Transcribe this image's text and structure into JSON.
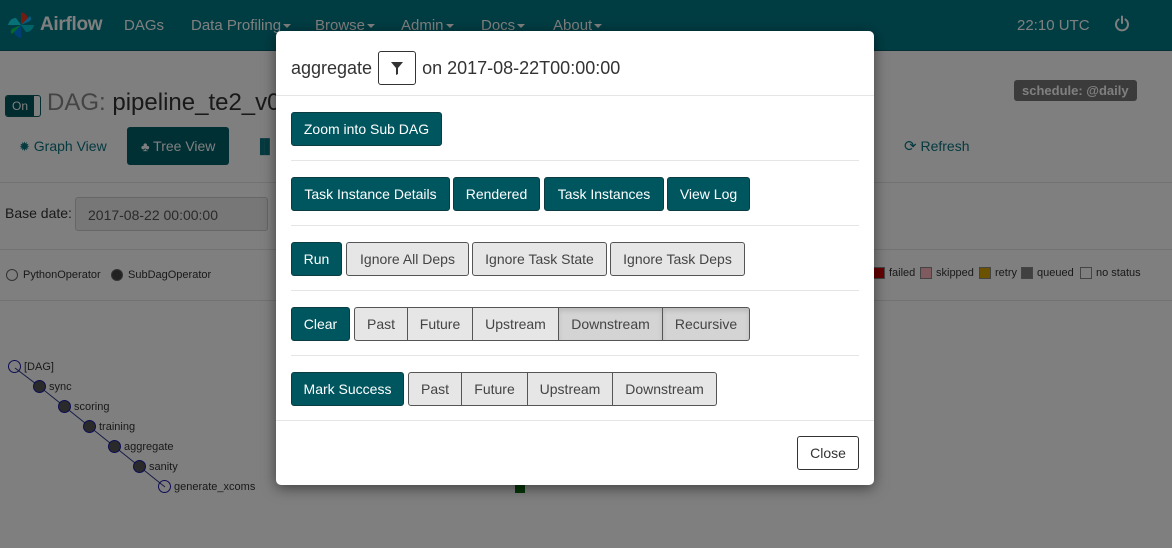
{
  "navbar": {
    "brand": "Airflow",
    "items": [
      {
        "label": "DAGs",
        "dropdown": false
      },
      {
        "label": "Data Profiling",
        "dropdown": true
      },
      {
        "label": "Browse",
        "dropdown": true
      },
      {
        "label": "Admin",
        "dropdown": true
      },
      {
        "label": "Docs",
        "dropdown": true
      },
      {
        "label": "About",
        "dropdown": true
      }
    ],
    "clock": "22:10 UTC"
  },
  "dag": {
    "toggle": "On",
    "title_label": "DAG:",
    "title_name": "pipeline_te2_v0",
    "schedule": "schedule: @daily"
  },
  "tabs": {
    "graph": "Graph View",
    "tree": "Tree View",
    "refresh": "Refresh"
  },
  "base_date": {
    "label": "Base date:",
    "value": "2017-08-22 00:00:00"
  },
  "legend": {
    "operators": [
      "PythonOperator",
      "SubDagOperator"
    ],
    "states": [
      {
        "label": "failed",
        "color": "#cc0000"
      },
      {
        "label": "skipped",
        "color": "#ffb6c1"
      },
      {
        "label": "retry",
        "color": "#d4a400"
      },
      {
        "label": "queued",
        "color": "#808080"
      },
      {
        "label": "no status",
        "color": "#ffffff"
      }
    ]
  },
  "tree": {
    "nodes": [
      {
        "label": "[DAG]",
        "filled": false
      },
      {
        "label": "sync",
        "filled": true
      },
      {
        "label": "scoring",
        "filled": true
      },
      {
        "label": "training",
        "filled": true
      },
      {
        "label": "aggregate",
        "filled": true
      },
      {
        "label": "sanity",
        "filled": true
      },
      {
        "label": "generate_xcoms",
        "filled": false
      }
    ]
  },
  "modal": {
    "task": "aggregate",
    "on_text": "on 2017-08-22T00:00:00",
    "zoom": "Zoom into Sub DAG",
    "info_buttons": {
      "details": "Task Instance Details",
      "rendered": "Rendered",
      "instances": "Task Instances",
      "log": "View Log"
    },
    "run": {
      "label": "Run",
      "ignore_all": "Ignore All Deps",
      "ignore_state": "Ignore Task State",
      "ignore_deps": "Ignore Task Deps"
    },
    "clear": {
      "label": "Clear",
      "past": "Past",
      "future": "Future",
      "upstream": "Upstream",
      "downstream": "Downstream",
      "recursive": "Recursive"
    },
    "mark": {
      "label": "Mark Success",
      "past": "Past",
      "future": "Future",
      "upstream": "Upstream",
      "downstream": "Downstream"
    },
    "close": "Close"
  },
  "colors": {
    "navbar": "#007a87",
    "primary_button": "#00565f"
  }
}
